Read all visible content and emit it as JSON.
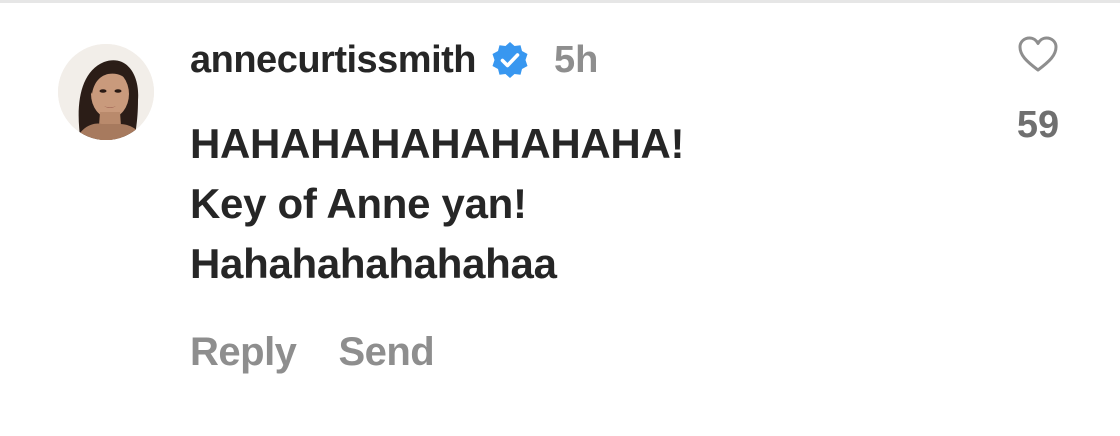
{
  "comment": {
    "username": "annecurtissmith",
    "verified_icon": "verified-badge-icon",
    "time": "5h",
    "text_lines": [
      "HAHAHAHAHAHAHAHA!",
      "Key of Anne yan!",
      "Hahahahahahahaa"
    ],
    "like_count": "59",
    "actions": {
      "reply": "Reply",
      "send": "Send"
    }
  },
  "colors": {
    "verified": "#3897f0",
    "muted_text": "#8e8e8e",
    "primary_text": "#262626"
  }
}
